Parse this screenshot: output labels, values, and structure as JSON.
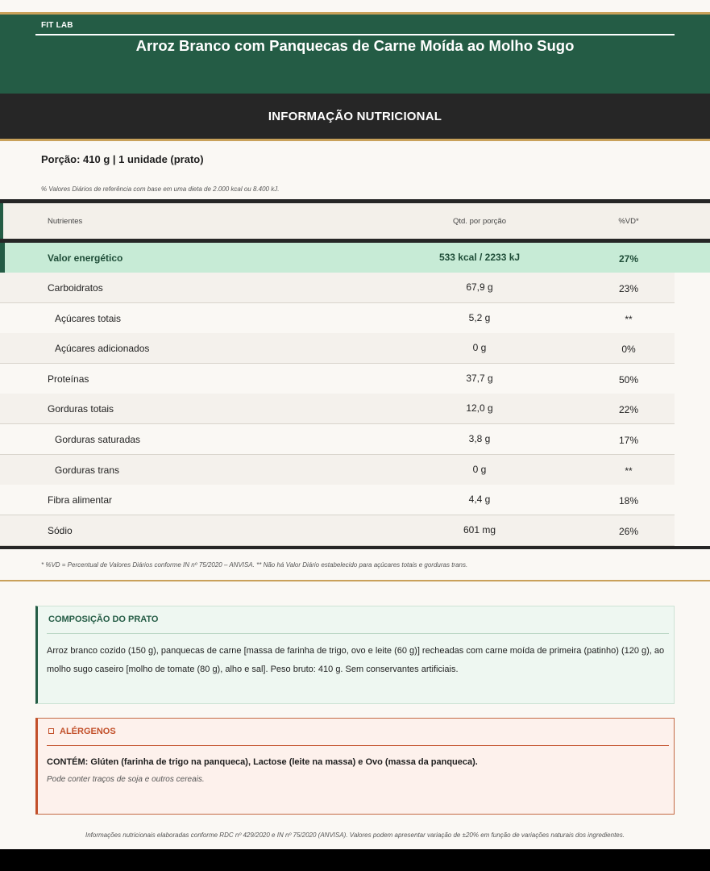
{
  "brand": "FIT LAB",
  "product_title": "Arroz Branco com Panquecas de Carne Moída ao Molho Sugo",
  "section_title": "INFORMAÇÃO NUTRICIONAL",
  "portion": "Porção: 410 g  |  1 unidade (prato)",
  "vd_reference": "% Valores Diários de referência com base em uma dieta de 2.000 kcal ou 8.400 kJ.",
  "table": {
    "headers": {
      "nutrient": "Nutrientes",
      "qty": "Qtd. por porção",
      "vd": "%VD*"
    },
    "energy": {
      "name": "Valor energético",
      "qty": "533 kcal / 2233 kJ",
      "vd": "27%"
    },
    "rows": [
      {
        "name": "Carboidratos",
        "qty": "67,9 g",
        "vd": "23%"
      },
      {
        "name": "Açúcares totais",
        "qty": "5,2 g",
        "vd": "**"
      },
      {
        "name": "Açúcares adicionados",
        "qty": "0 g",
        "vd": "0%"
      },
      {
        "name": "Proteínas",
        "qty": "37,7 g",
        "vd": "50%"
      },
      {
        "name": "Gorduras totais",
        "qty": "12,0 g",
        "vd": "22%"
      },
      {
        "name": "Gorduras saturadas",
        "qty": "3,8 g",
        "vd": "17%"
      },
      {
        "name": "Gorduras trans",
        "qty": "0 g",
        "vd": "**"
      },
      {
        "name": "Fibra alimentar",
        "qty": "4,4 g",
        "vd": "18%"
      },
      {
        "name": "Sódio",
        "qty": "601 mg",
        "vd": "26%"
      }
    ]
  },
  "footnote": "* %VD = Percentual de Valores Diários conforme IN nº 75/2020 – ANVISA.   ** Não há Valor Diário estabelecido para açúcares totais e gorduras trans.",
  "composition": {
    "title": "COMPOSIÇÃO DO PRATO",
    "text": "Arroz branco cozido (150 g), panquecas de carne [massa de farinha de trigo, ovo e leite (60 g)] recheadas com carne moída de primeira (patinho) (120 g), ao molho sugo caseiro [molho de tomate (80 g), alho e sal]. Peso bruto: 410 g. Sem conservantes artificiais."
  },
  "allergens": {
    "icon": "warning-icon",
    "title": "ALÉRGENOS",
    "contains": "CONTÉM: Glúten (farinha de trigo na panqueca), Lactose (leite na massa) e Ovo (massa da panqueca).",
    "may_contain": "Pode conter traços de soja e outros cereais."
  },
  "legal": "Informações nutricionais elaboradas conforme RDC nº 429/2020 e IN nº 75/2020 (ANVISA). Valores podem apresentar variação de ±20% em função de variações naturais dos ingredientes.",
  "colors": {
    "brand_green": "#245c45",
    "dark_bar": "#262626",
    "gold_rule": "#c9a15a",
    "energy_highlight": "#c7ebd6",
    "allergen_accent": "#c2502a"
  }
}
